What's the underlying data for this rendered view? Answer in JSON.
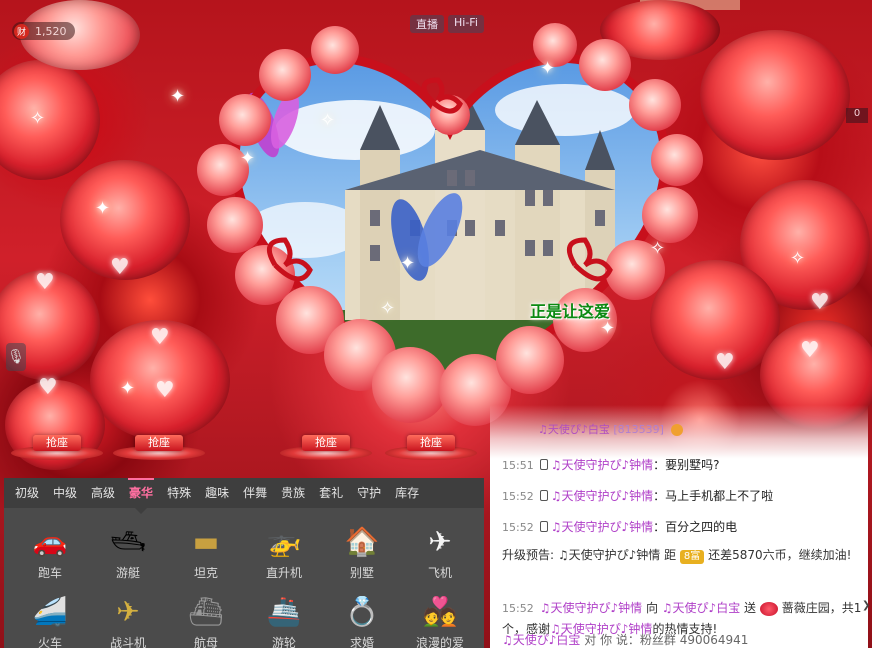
{
  "header": {
    "coin_icon_label": "财",
    "coin_count": "1,520",
    "live_label": "直播",
    "quality_label": "Hi-Fi",
    "right_counter": "0"
  },
  "scene": {
    "caption": "正是让这爱"
  },
  "seats": [
    {
      "label": "抢座"
    },
    {
      "label": "抢座"
    },
    {
      "label": "抢座"
    },
    {
      "label": "抢座"
    }
  ],
  "gift_panel": {
    "tabs": [
      {
        "label": "初级"
      },
      {
        "label": "中级"
      },
      {
        "label": "高级"
      },
      {
        "label": "豪华",
        "active": true
      },
      {
        "label": "特殊"
      },
      {
        "label": "趣味"
      },
      {
        "label": "伴舞"
      },
      {
        "label": "贵族"
      },
      {
        "label": "套礼"
      },
      {
        "label": "守护"
      },
      {
        "label": "库存"
      }
    ],
    "gifts": [
      {
        "name": "跑车",
        "icon": "sports-car-icon"
      },
      {
        "name": "游艇",
        "icon": "yacht-icon"
      },
      {
        "name": "坦克",
        "icon": "tank-icon"
      },
      {
        "name": "直升机",
        "icon": "helicopter-icon"
      },
      {
        "name": "别墅",
        "icon": "villa-icon"
      },
      {
        "name": "飞机",
        "icon": "airplane-icon"
      },
      {
        "name": "火车",
        "icon": "train-icon"
      },
      {
        "name": "战斗机",
        "icon": "fighter-jet-icon"
      },
      {
        "name": "航母",
        "icon": "aircraft-carrier-icon"
      },
      {
        "name": "游轮",
        "icon": "cruise-ship-icon"
      },
      {
        "name": "求婚",
        "icon": "proposal-icon"
      },
      {
        "name": "浪漫的爱",
        "icon": "romantic-love-icon"
      }
    ]
  },
  "chat": {
    "top_user": "♫天使ぴ♪白宝",
    "top_user_id": "[813539]",
    "messages": [
      {
        "time": "15:51",
        "user": "♫天使守护ぴ♪钟情",
        "sep": "：",
        "text": "要别墅吗?"
      },
      {
        "time": "15:52",
        "user": "♫天使守护ぴ♪钟情",
        "sep": "：",
        "text": "马上手机都上不了啦"
      },
      {
        "time": "15:52",
        "user": "♫天使守护ぴ♪钟情",
        "sep": "：",
        "text": "百分之四的电"
      }
    ],
    "upgrade_note": {
      "prefix": "升级预告: ♫天使守护ぴ♪钟情 距",
      "rank": "8富",
      "suffix": "还差5870六币，继续加油!"
    },
    "gift_message": {
      "time": "15:52",
      "sender": "♫天使守护ぴ♪钟情",
      "to": "向",
      "receiver": "♫天使ぴ♪白宝",
      "action": "送",
      "gift": "蔷薇庄园，共1个，感谢",
      "thanks_user": "♫天使守护ぴ♪钟情",
      "tail": "的热情支持!"
    },
    "bottom_line": {
      "user": "♫天使ぴ♪白宝",
      "text": "对 你 说：粉丝群 490064941"
    }
  }
}
